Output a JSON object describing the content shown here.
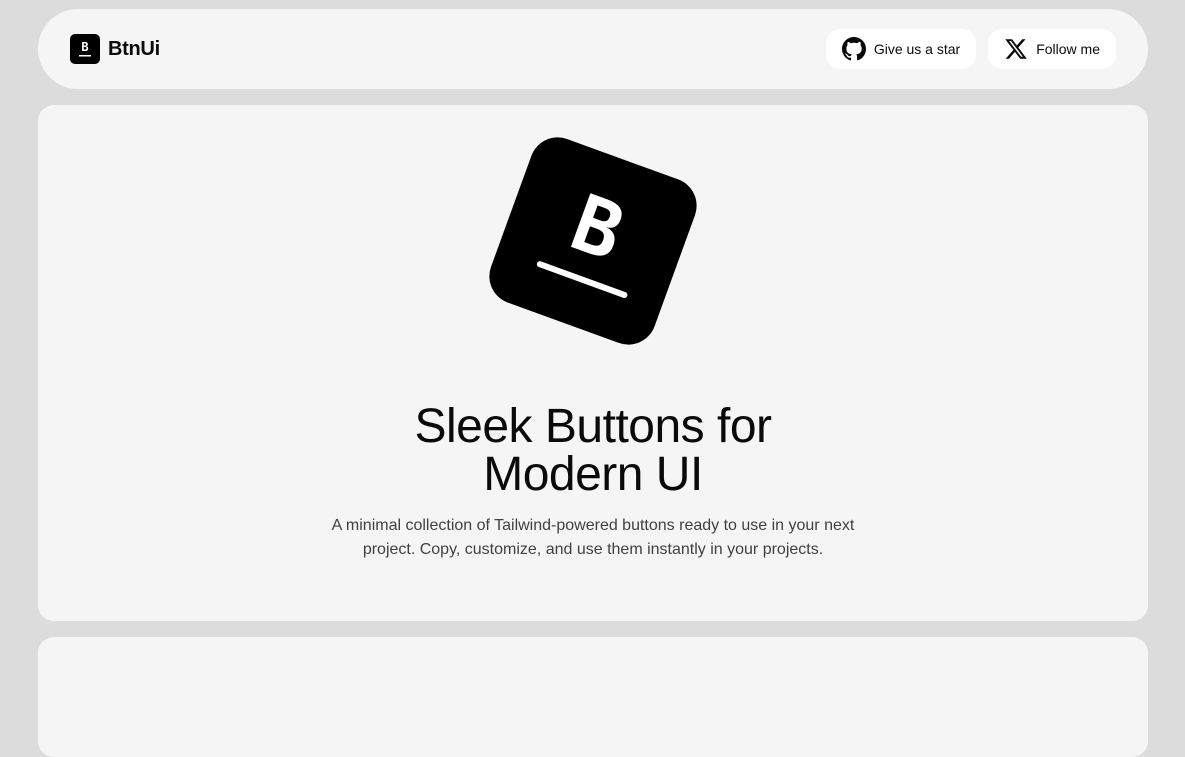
{
  "navbar": {
    "brand_name": "BtnUi",
    "brand_logo_letter": "B",
    "actions": [
      {
        "label": "Give us a star",
        "icon": "github-icon"
      },
      {
        "label": "Follow me",
        "icon": "x-twitter-icon"
      }
    ]
  },
  "hero": {
    "logo_letter": "B",
    "title_line1": "Sleek Buttons for",
    "title_line2": "Modern UI",
    "subtitle_line1": "A minimal collection of Tailwind-powered buttons ready to use in your next",
    "subtitle_line2": "project. Copy, customize, and use them instantly in your projects."
  },
  "colors": {
    "page_bg": "#dcdcdc",
    "card_bg": "#f5f5f5",
    "button_bg": "#ffffff",
    "logo_bg": "#000000",
    "text": "#0a0a0a",
    "muted_text": "#3f3f46"
  }
}
